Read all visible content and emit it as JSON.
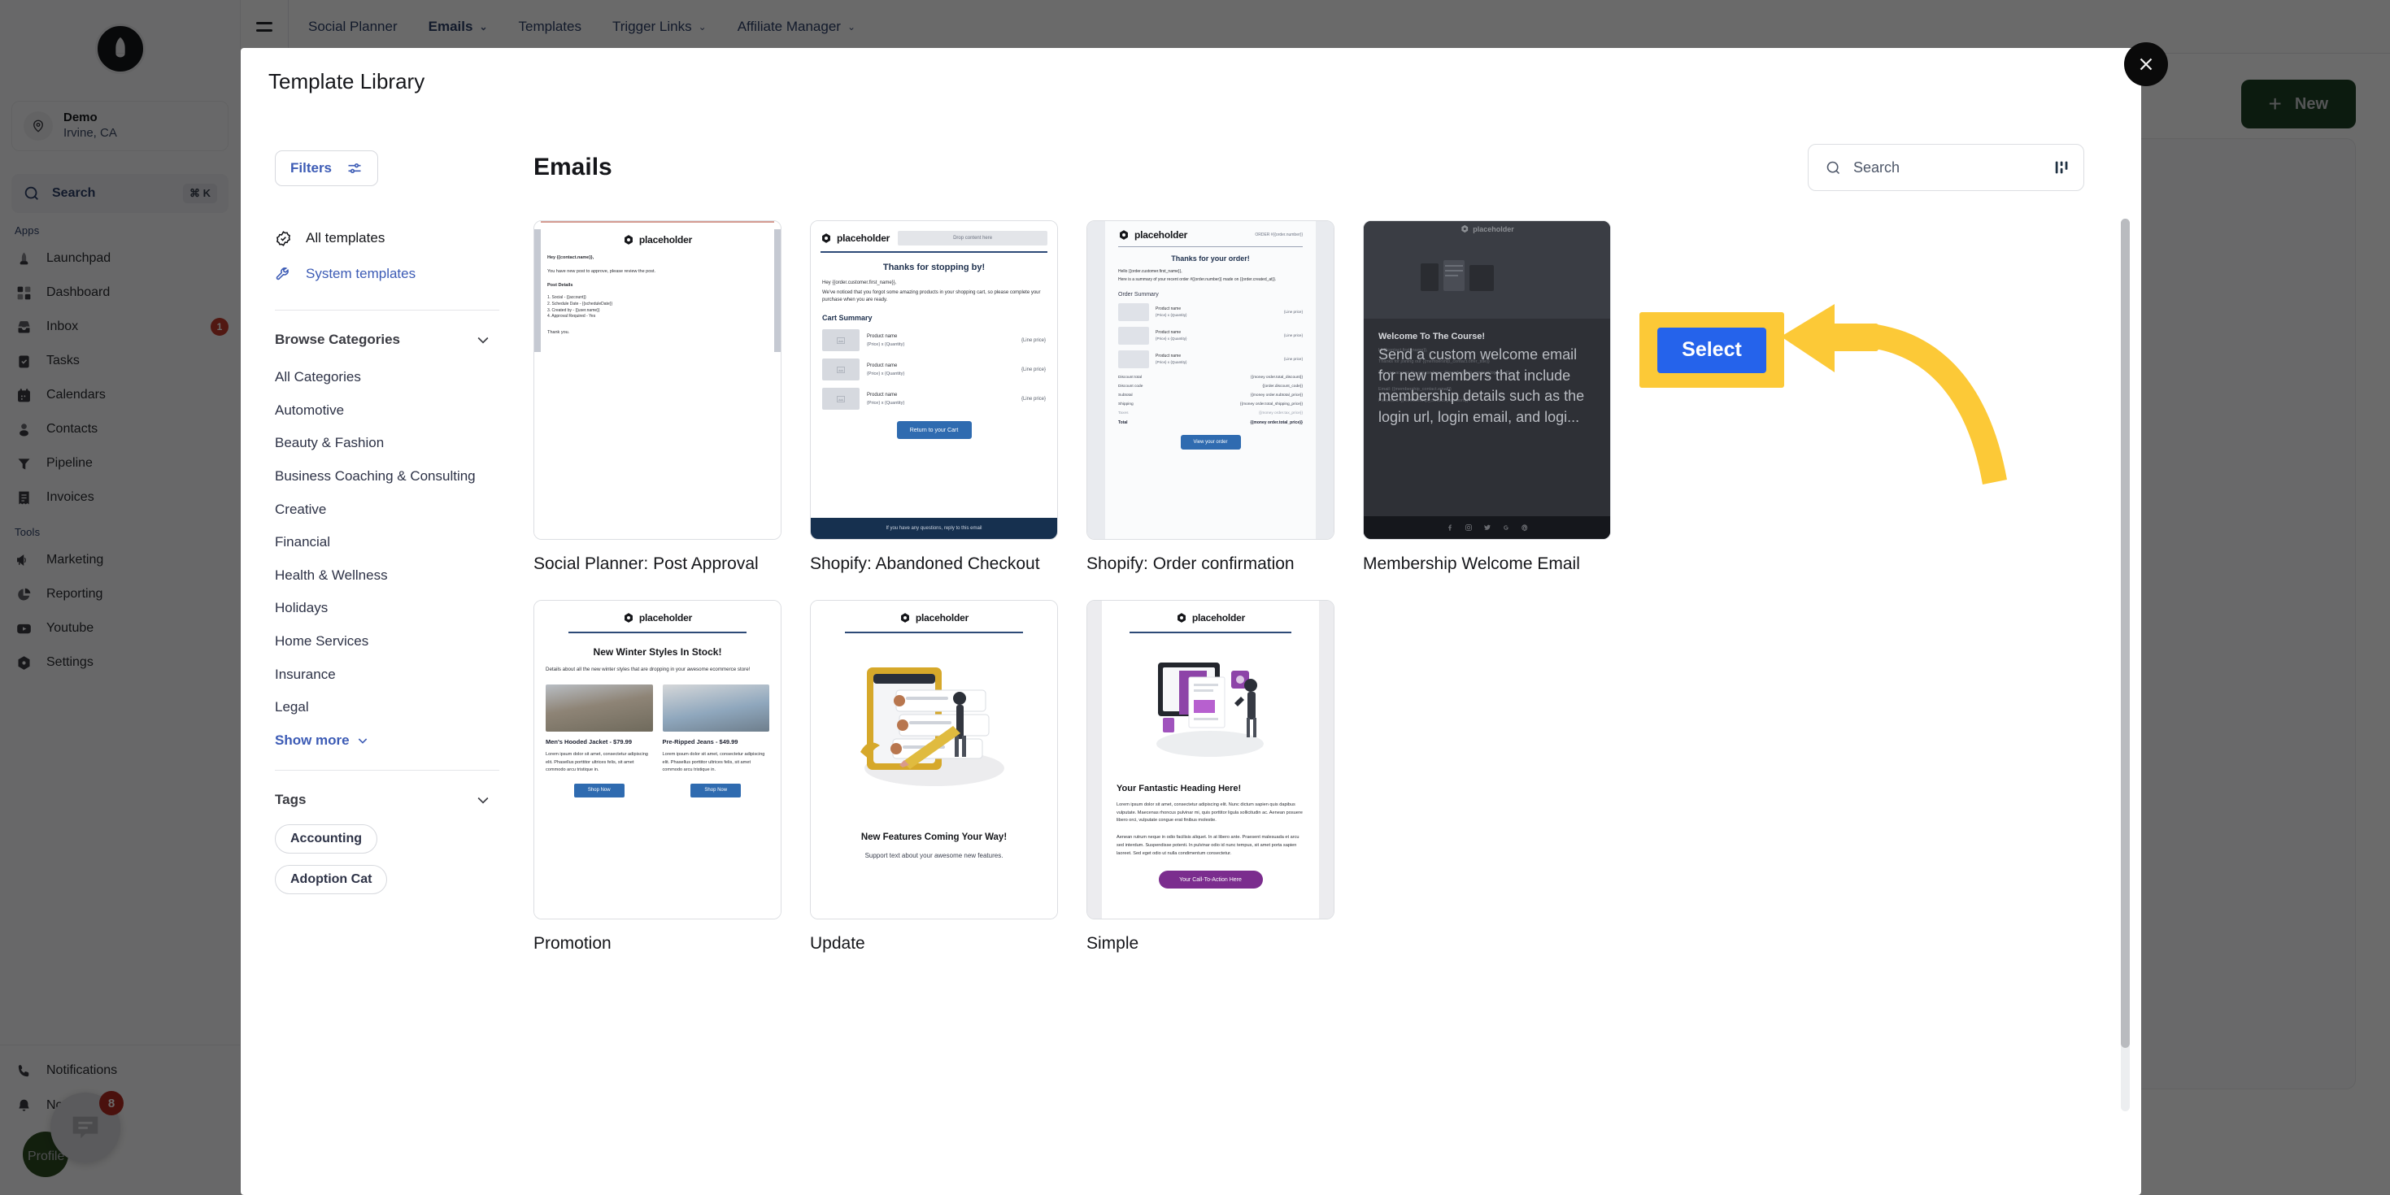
{
  "app": {
    "sidebar": {
      "logo_icon": "rocket-logo-icon",
      "location": {
        "name": "Demo",
        "sub": "Irvine, CA",
        "icon": "location-pin-icon"
      },
      "search": {
        "label": "Search",
        "shortcut": "⌘ K",
        "icon": "search-icon"
      },
      "groups": [
        {
          "label": "Apps",
          "items": [
            {
              "label": "Launchpad",
              "icon": "launchpad-icon"
            },
            {
              "label": "Dashboard",
              "icon": "dashboard-grid-icon"
            },
            {
              "label": "Inbox",
              "icon": "inbox-icon",
              "badge": "1"
            },
            {
              "label": "Tasks",
              "icon": "tasks-clipboard-icon"
            },
            {
              "label": "Calendars",
              "icon": "calendar-icon"
            },
            {
              "label": "Contacts",
              "icon": "contacts-person-icon"
            },
            {
              "label": "Pipeline",
              "icon": "pipeline-funnel-icon"
            },
            {
              "label": "Invoices",
              "icon": "invoice-receipt-icon"
            }
          ]
        },
        {
          "label": "Tools",
          "items": [
            {
              "label": "Marketing",
              "icon": "megaphone-icon"
            },
            {
              "label": "Reporting",
              "icon": "pie-chart-icon"
            },
            {
              "label": "Youtube",
              "icon": "youtube-icon"
            },
            {
              "label": "Settings",
              "icon": "settings-gear-icon"
            }
          ]
        }
      ],
      "footer_items": [
        {
          "label": "Phone",
          "icon": "phone-icon"
        },
        {
          "label": "Notifications",
          "icon": "bell-icon"
        },
        {
          "label": "Profile",
          "icon": "avatar-icon"
        }
      ],
      "chat_widget": {
        "badge": "8",
        "icon": "chat-bubble-icon"
      }
    },
    "topbar": {
      "menu_icon": "hamburger-menu-icon",
      "tabs": [
        {
          "label": "Social Planner",
          "active": false,
          "has_caret": false
        },
        {
          "label": "Emails",
          "active": true,
          "has_caret": true
        },
        {
          "label": "Templates",
          "active": false,
          "has_caret": false
        },
        {
          "label": "Trigger Links",
          "active": false,
          "has_caret": true
        },
        {
          "label": "Affiliate Manager",
          "active": false,
          "has_caret": true
        }
      ]
    },
    "new_button": {
      "label": "New",
      "icon": "plus-icon"
    }
  },
  "modal": {
    "title": "Template Library",
    "close_icon": "close-x-icon",
    "filters": {
      "button_label": "Filters",
      "button_icon": "sliders-icon",
      "quick": [
        {
          "label": "All templates",
          "icon": "check-badge-icon",
          "active": true
        },
        {
          "label": "System templates",
          "icon": "wrench-icon",
          "active": false
        }
      ],
      "browse_categories": {
        "label": "Browse Categories",
        "icon": "chevron-down-icon"
      },
      "categories": [
        "All Categories",
        "Automotive",
        "Beauty & Fashion",
        "Business Coaching & Consulting",
        "Creative",
        "Financial",
        "Health & Wellness",
        "Holidays",
        "Home Services",
        "Insurance",
        "Legal"
      ],
      "show_more": {
        "label": "Show more",
        "icon": "chevron-down-icon"
      },
      "tags_header": {
        "label": "Tags",
        "icon": "chevron-down-icon"
      },
      "tags": [
        "Accounting",
        "Adoption Cat"
      ]
    },
    "grid": {
      "heading": "Emails",
      "search": {
        "placeholder": "Search",
        "value": "",
        "icon": "search-icon",
        "sort_icon": "sort-bars-icon"
      },
      "cards": [
        {
          "title": "Social Planner: Post Approval",
          "preview": {
            "brand": "placeholder",
            "greeting": "Hey {{contact.name}},",
            "intro": "You have new post to approve, please review the post.",
            "section": "Post Details",
            "list": [
              "1. Social - {{account}}",
              "2. Schedule Date - {{scheduleDate}}",
              "3. Created by - {{user.name}}",
              "4. Approval Required - Yes"
            ],
            "closing": "Thank you."
          }
        },
        {
          "title": "Shopify: Abandoned Checkout",
          "preview": {
            "brand": "placeholder",
            "drop_zone": "Drop content here",
            "heading": "Thanks for stopping by!",
            "greeting": "Hey {{order.customer.first_name}},",
            "body": "We've noticed that you forgot some amazing products in your shopping cart, so please complete your purchase when you are ready.",
            "section": "Cart Summary",
            "items": [
              {
                "name": "Product name",
                "meta": "{Price} x {Quantity}",
                "price": "{Line price}"
              },
              {
                "name": "Product name",
                "meta": "{Price} x {Quantity}",
                "price": "{Line price}"
              },
              {
                "name": "Product name",
                "meta": "{Price} x {Quantity}",
                "price": "{Line price}"
              }
            ],
            "cta": "Return to your Cart",
            "footer": "If you have any questions, reply to this email"
          }
        },
        {
          "title": "Shopify: Order confirmation",
          "preview": {
            "brand": "placeholder",
            "order_ref": "ORDER #{{order.number}}",
            "heading": "Thanks for your order!",
            "greeting": "Hello {{order.customer.first_name}},",
            "body": "Here is a summary of your recent order #{{order.number}} made on {{order.created_at}}.",
            "section": "Order Summary",
            "items": [
              {
                "name": "Product name",
                "meta": "{Price} x {Quantity}",
                "price": "{Line price}"
              },
              {
                "name": "Product name",
                "meta": "{Price} x {Quantity}",
                "price": "{Line price}"
              },
              {
                "name": "Product name",
                "meta": "{Price} x {Quantity}",
                "price": "{Line price}"
              }
            ],
            "totals": [
              {
                "label": "Discount total",
                "value": "{{money order.total_discount}}"
              },
              {
                "label": "Discount code",
                "value": "{{order.discount_code}}"
              },
              {
                "label": "Subtotal",
                "value": "{{money order.subtotal_price}}"
              },
              {
                "label": "Shipping",
                "value": "{{money order.total_shipping_price}}"
              },
              {
                "label": "Taxes",
                "value": "{{money order.tax_price}}"
              },
              {
                "label": "Total",
                "value": "{{money order.total_price}}"
              }
            ],
            "cta": "View your order"
          }
        },
        {
          "title": "Membership Welcome Email",
          "selected": true,
          "select_button": "Select",
          "preview": {
            "brand": "placeholder",
            "heading": "Welcome To The Course!",
            "greeting": "Hi {{contact.first_name}},",
            "line1": "Thanks for joining our {{membership_contact.offer_title}}",
            "line2": "You can access the course here: {{membership_contact.login_url}}",
            "line3": "Email: {{membership_contact.email}}",
            "line4": "Password: {{membership_contact.password}}",
            "description": "Send a custom welcome email for new members that include membership details such as the login url, login email, and logi...",
            "social_icons": [
              "facebook-icon",
              "instagram-icon",
              "twitter-icon",
              "google-plus-icon",
              "pinterest-icon"
            ]
          }
        },
        {
          "title": "Promotion",
          "preview": {
            "brand": "placeholder",
            "heading": "New Winter Styles In Stock!",
            "body": "Details about all the new winter styles that are dropping in your awesome ecommerce store!",
            "products": [
              {
                "name": "Men's Hooded Jacket - $79.99",
                "desc": "Lorem ipsum dolor sit amet, consectetur adipiscing elit. Phasellus porttitor ultrices felis, sit amet commodo arcu tristique in.",
                "cta": "Shop Now"
              },
              {
                "name": "Pre-Ripped Jeans - $49.99",
                "desc": "Lorem ipsum dolor sit amet, consectetur adipiscing elit. Phasellus porttitor ultrices felis, sit amet commodo arcu tristique in.",
                "cta": "Shop Now"
              }
            ]
          }
        },
        {
          "title": "Update",
          "preview": {
            "brand": "placeholder",
            "heading": "New Features Coming Your Way!",
            "subtext": "Support text about your awesome new features."
          }
        },
        {
          "title": "Simple",
          "preview": {
            "brand": "placeholder",
            "heading": "Your Fantastic Heading Here!",
            "para1": "Lorem ipsum dolor sit amet, consectetur adipiscing elit. Nunc dictum sapien quis dapibus vulputate. Maecenas rhoncus pulvinar mi, quis porttitor ligula sollicitudin ac. Aenean posuere libero orci, vulputate congue erat finibus molestie.",
            "para2": "Aenean rutrum neque in odio facilisis aliquet. In at libero ante. Praesent malesuada et arcu sed interdum. Suspendisse potenti. In pulvinar odio id nunc tempus, sit amet porta sapien laoreet. Sed eget odio ut nulla condimentum consectetur.",
            "cta": "Your Call-To-Action Here"
          }
        }
      ]
    }
  },
  "annotation": {
    "highlight_color": "#fcc937",
    "button_color": "#2563eb",
    "button_label": "Select",
    "arrow_icon": "curved-arrow-left-icon"
  }
}
